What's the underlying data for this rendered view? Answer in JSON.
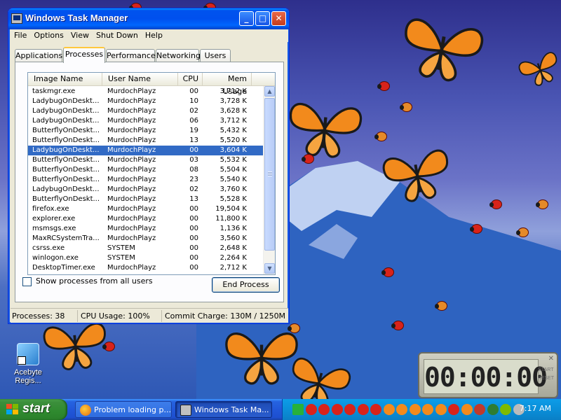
{
  "window": {
    "title": "Windows Task Manager",
    "menu": [
      "File",
      "Options",
      "View",
      "Shut Down",
      "Help"
    ],
    "tabs": [
      "Applications",
      "Processes",
      "Performance",
      "Networking",
      "Users"
    ],
    "active_tab": "Processes",
    "columns": [
      "Image Name",
      "User Name",
      "CPU",
      "Mem Usage"
    ],
    "processes": [
      {
        "image": "taskmgr.exe",
        "user": "MurdochPlayz",
        "cpu": "00",
        "mem": "3,712 K"
      },
      {
        "image": "LadybugOnDeskt...",
        "user": "MurdochPlayz",
        "cpu": "10",
        "mem": "3,728 K"
      },
      {
        "image": "LadybugOnDeskt...",
        "user": "MurdochPlayz",
        "cpu": "02",
        "mem": "3,628 K"
      },
      {
        "image": "LadybugOnDeskt...",
        "user": "MurdochPlayz",
        "cpu": "06",
        "mem": "3,712 K"
      },
      {
        "image": "ButterflyOnDeskt...",
        "user": "MurdochPlayz",
        "cpu": "19",
        "mem": "5,432 K"
      },
      {
        "image": "ButterflyOnDeskt...",
        "user": "MurdochPlayz",
        "cpu": "13",
        "mem": "5,520 K"
      },
      {
        "image": "LadybugOnDeskt...",
        "user": "MurdochPlayz",
        "cpu": "00",
        "mem": "3,604 K",
        "selected": true
      },
      {
        "image": "ButterflyOnDeskt...",
        "user": "MurdochPlayz",
        "cpu": "03",
        "mem": "5,532 K"
      },
      {
        "image": "ButterflyOnDeskt...",
        "user": "MurdochPlayz",
        "cpu": "08",
        "mem": "5,504 K"
      },
      {
        "image": "ButterflyOnDeskt...",
        "user": "MurdochPlayz",
        "cpu": "23",
        "mem": "5,540 K"
      },
      {
        "image": "LadybugOnDeskt...",
        "user": "MurdochPlayz",
        "cpu": "02",
        "mem": "3,760 K"
      },
      {
        "image": "ButterflyOnDeskt...",
        "user": "MurdochPlayz",
        "cpu": "13",
        "mem": "5,528 K"
      },
      {
        "image": "firefox.exe",
        "user": "MurdochPlayz",
        "cpu": "00",
        "mem": "19,504 K"
      },
      {
        "image": "explorer.exe",
        "user": "MurdochPlayz",
        "cpu": "00",
        "mem": "11,800 K"
      },
      {
        "image": "msmsgs.exe",
        "user": "MurdochPlayz",
        "cpu": "00",
        "mem": "1,136 K"
      },
      {
        "image": "MaxRCSystemTra...",
        "user": "MurdochPlayz",
        "cpu": "00",
        "mem": "3,560 K"
      },
      {
        "image": "csrss.exe",
        "user": "SYSTEM",
        "cpu": "00",
        "mem": "2,648 K"
      },
      {
        "image": "winlogon.exe",
        "user": "SYSTEM",
        "cpu": "00",
        "mem": "2,264 K"
      },
      {
        "image": "DesktopTimer.exe",
        "user": "MurdochPlayz",
        "cpu": "00",
        "mem": "2,712 K"
      }
    ],
    "show_all_label": "Show processes from all users",
    "show_all_checked": false,
    "end_process_label": "End Process",
    "status": {
      "processes": "Processes: 38",
      "cpu": "CPU Usage: 100%",
      "commit": "Commit Charge: 130M / 1250M"
    }
  },
  "desktop": {
    "icon_label": "Acebyte Regis...",
    "timer": {
      "display": "00:00:00",
      "start_label": "START",
      "reset_label": "RESET"
    }
  },
  "taskbar": {
    "start_label": "start",
    "buttons": [
      {
        "label": "Problem loading p...",
        "icon": "firefox-icon",
        "active": false
      },
      {
        "label": "Windows Task Ma...",
        "icon": "task-manager-icon",
        "active": true
      }
    ],
    "clock": "7:17 AM"
  },
  "colors": {
    "selection": "#316ac5",
    "titlebar": "#0050ee",
    "butterfly": "#f28a1c",
    "ladybug": "#d8231a"
  }
}
